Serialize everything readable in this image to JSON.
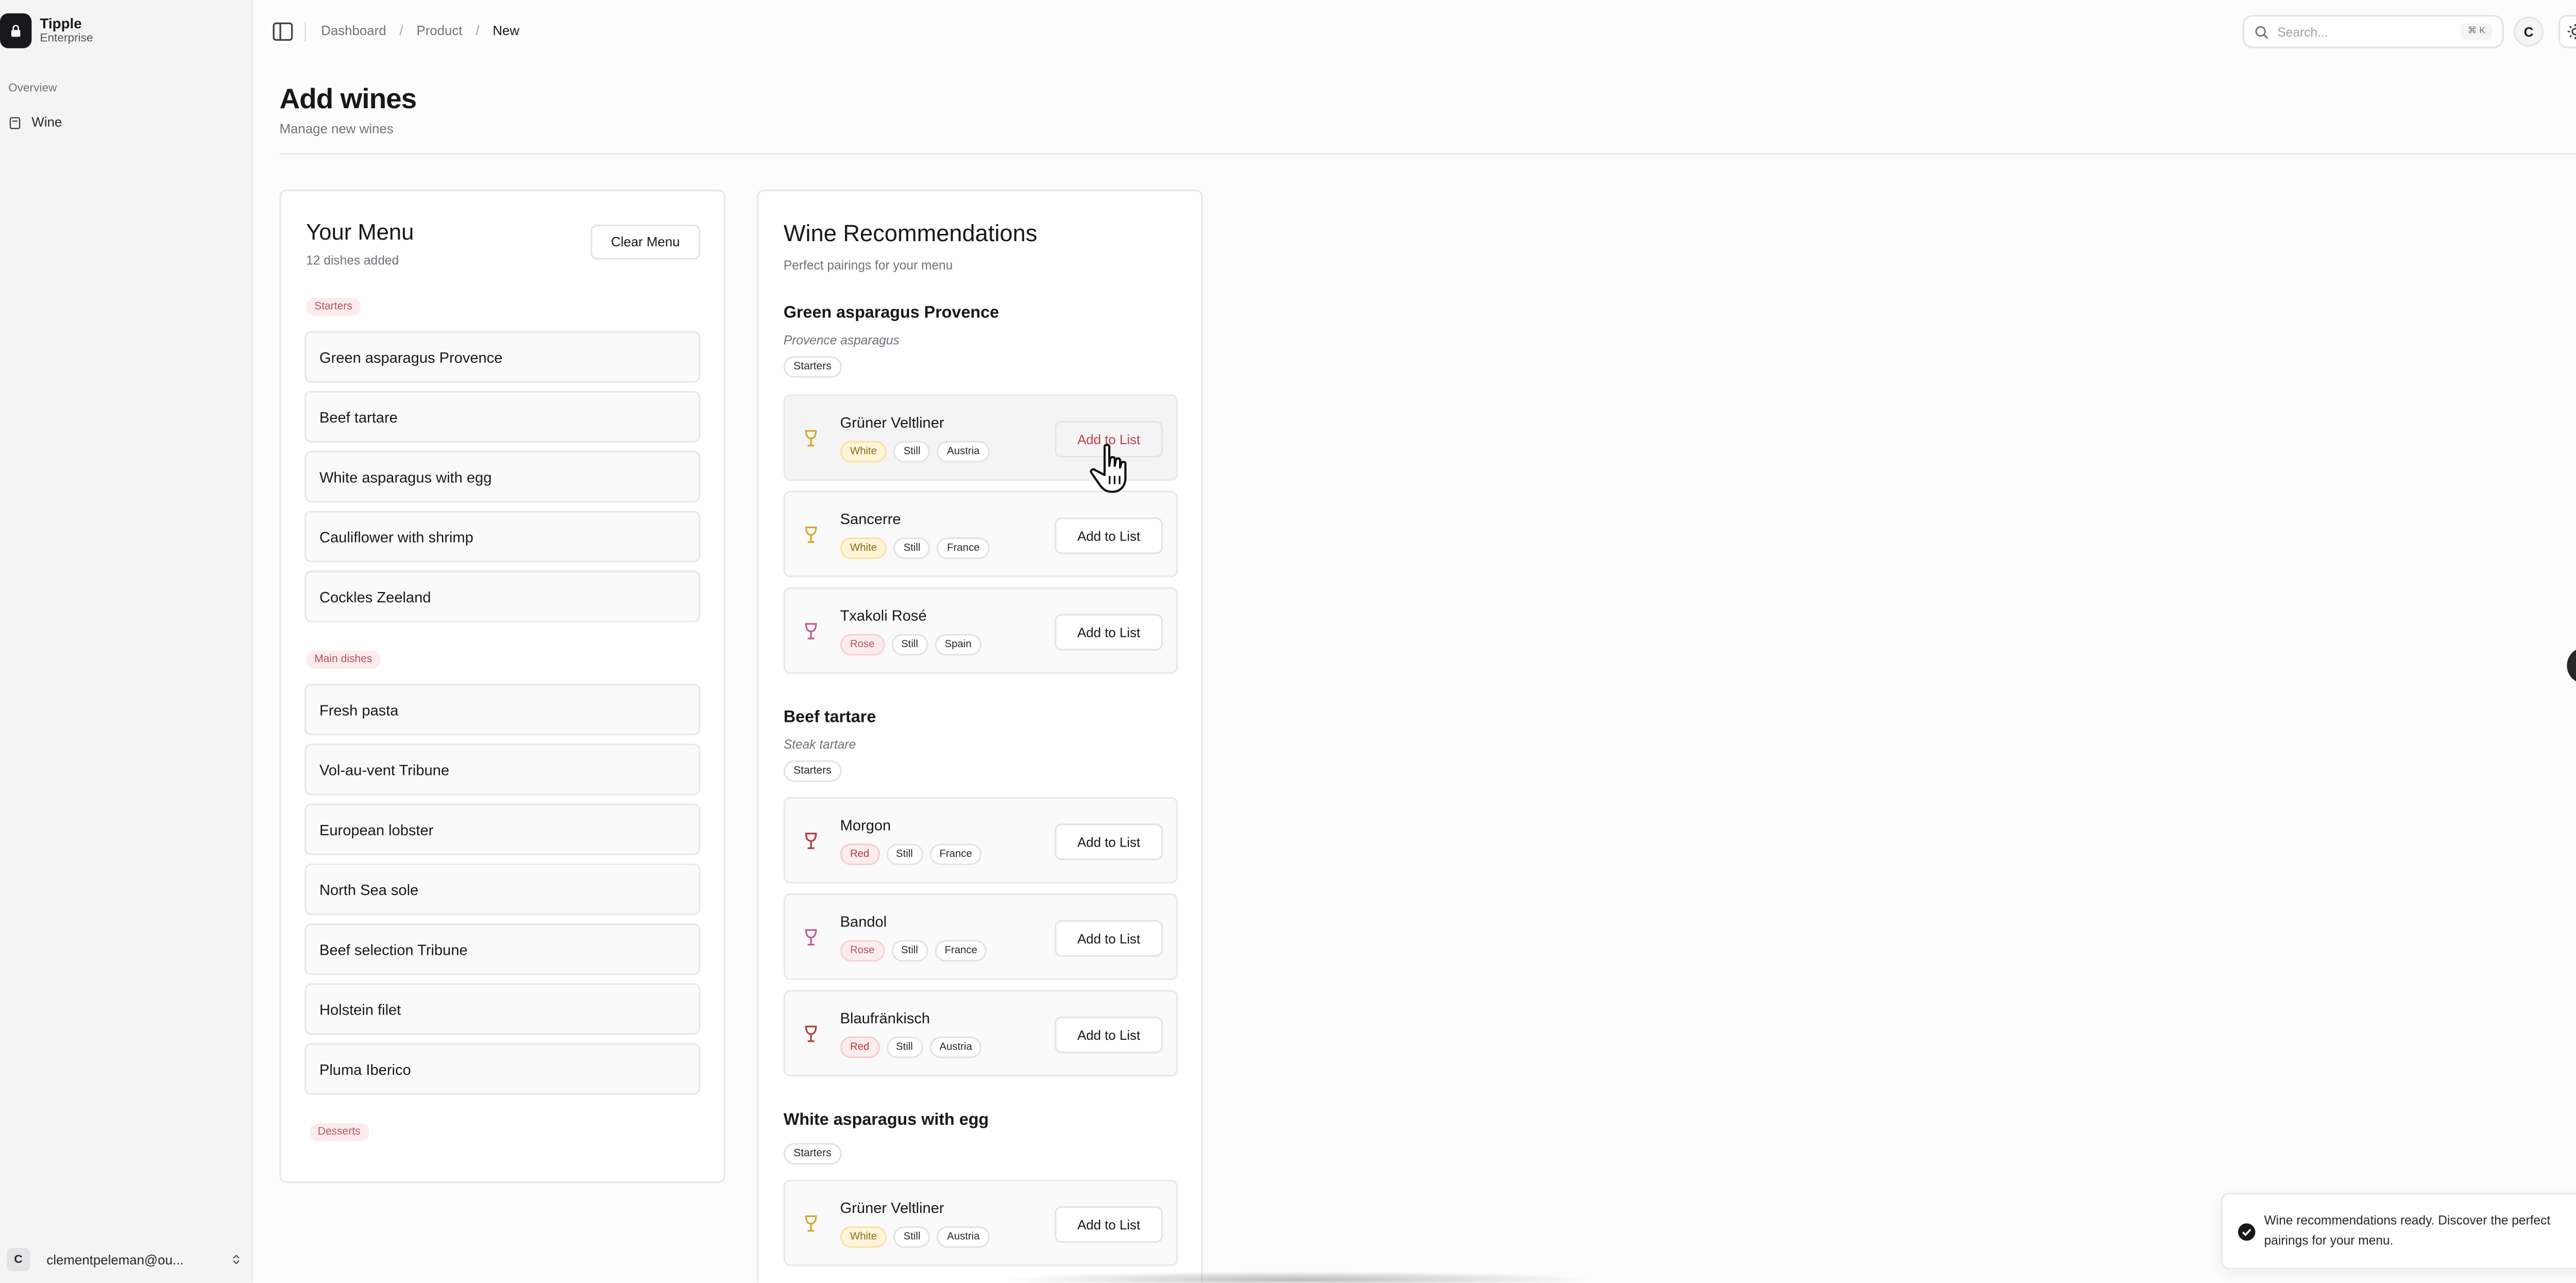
{
  "app": {
    "name": "Tipple",
    "plan": "Enterprise"
  },
  "sidebar": {
    "section": "Overview",
    "items": [
      {
        "label": "Wine",
        "icon": "wine-list-icon"
      }
    ],
    "user": {
      "initial": "C",
      "email": "clementpeleman@ou..."
    }
  },
  "header": {
    "breadcrumbs": [
      "Dashboard",
      "Product",
      "New"
    ],
    "search": {
      "placeholder": "Search...",
      "shortcut": "⌘ K"
    },
    "avatar_initial": "C"
  },
  "page": {
    "title": "Add wines",
    "subtitle": "Manage new wines"
  },
  "menu": {
    "title": "Your Menu",
    "count_text": "12 dishes added",
    "clear_label": "Clear Menu",
    "groups": [
      {
        "label": "Starters",
        "dishes": [
          "Green asparagus Provence",
          "Beef tartare",
          "White asparagus with egg",
          "Cauliflower with shrimp",
          "Cockles Zeeland"
        ]
      },
      {
        "label": "Main dishes",
        "dishes": [
          "Fresh pasta",
          "Vol-au-vent Tribune",
          "European lobster",
          "North Sea sole",
          "Beef selection Tribune",
          "Holstein filet",
          "Pluma Iberico"
        ]
      },
      {
        "label": "Desserts",
        "dishes": []
      }
    ]
  },
  "recommendations": {
    "title": "Wine Recommendations",
    "subtitle": "Perfect pairings for your menu",
    "button_label": "Add to List",
    "dishes": [
      {
        "name": "Green asparagus Provence",
        "description": "Provence asparagus",
        "course": "Starters",
        "wines": [
          {
            "name": "Grüner Veltliner",
            "color": "White",
            "style": "Still",
            "country": "Austria"
          },
          {
            "name": "Sancerre",
            "color": "White",
            "style": "Still",
            "country": "France"
          },
          {
            "name": "Txakoli Rosé",
            "color": "Rose",
            "style": "Still",
            "country": "Spain"
          }
        ]
      },
      {
        "name": "Beef tartare",
        "description": "Steak tartare",
        "course": "Starters",
        "wines": [
          {
            "name": "Morgon",
            "color": "Red",
            "style": "Still",
            "country": "France"
          },
          {
            "name": "Bandol",
            "color": "Rose",
            "style": "Still",
            "country": "France"
          },
          {
            "name": "Blaufränkisch",
            "color": "Red",
            "style": "Still",
            "country": "Austria"
          }
        ]
      },
      {
        "name": "White asparagus with egg",
        "description": "",
        "course": "Starters",
        "wines": [
          {
            "name": "Grüner Veltliner",
            "color": "White",
            "style": "Still",
            "country": "Austria"
          }
        ]
      }
    ]
  },
  "toast": {
    "message": "Wine recommendations ready. Discover the perfect pairings for your menu."
  },
  "colors": {
    "white_wine": "#d4a62a",
    "rose_wine": "#c75a8a",
    "red_wine": "#b43a3a",
    "accent_red": "#c2414f"
  }
}
